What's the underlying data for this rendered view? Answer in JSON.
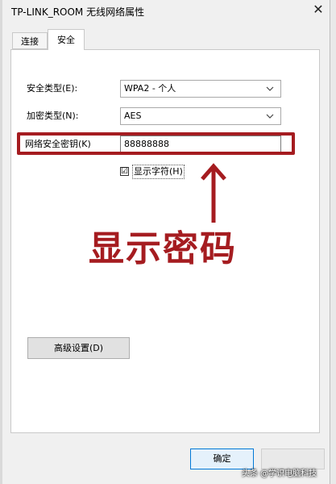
{
  "window": {
    "title": "TP-LINK_ROOM 无线网络属性",
    "close_glyph": "✕"
  },
  "tabs": [
    {
      "label": "连接"
    },
    {
      "label": "安全"
    }
  ],
  "security": {
    "security_type_label": "安全类型(E):",
    "security_type_value": "WPA2 - 个人",
    "encryption_type_label": "加密类型(N):",
    "encryption_type_value": "AES",
    "network_key_label": "网络安全密钥(K)",
    "network_key_value": "88888888",
    "show_chars_checked": "☑",
    "show_chars_label": "显示字符(H)"
  },
  "annotation": {
    "text": "显示密码",
    "color": "#a51c20"
  },
  "advanced_button": {
    "label": "高级设置(D)"
  },
  "footer": {
    "ok_label": "确定",
    "cancel_label": ""
  },
  "watermark": {
    "text": "头条 @学识电脑科技"
  },
  "icons": [
    "close-icon",
    "chevron-down-icon",
    "arrow-up-icon",
    "checkbox-icon"
  ]
}
